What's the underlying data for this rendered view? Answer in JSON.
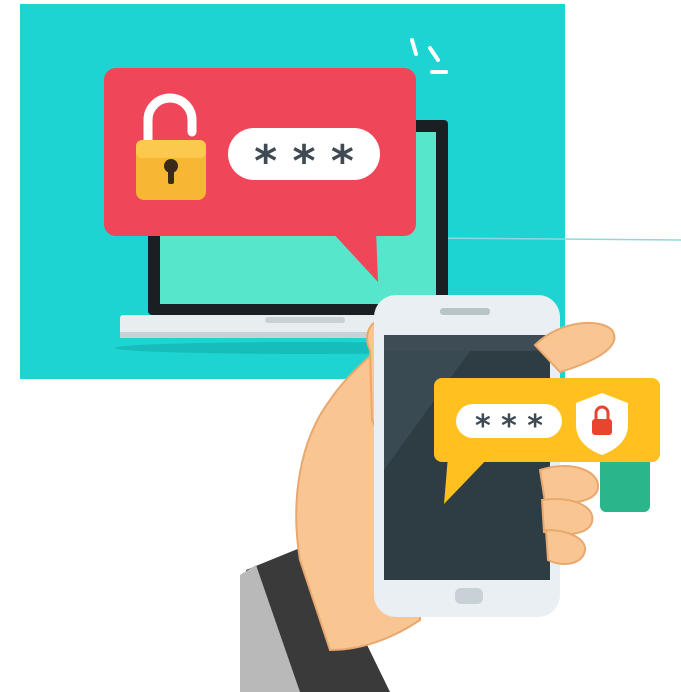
{
  "laptop_bubble": {
    "password_mask": "* * *"
  },
  "phone_bubble": {
    "password_mask": "* * *"
  },
  "colors": {
    "background_panel": "#1ED4D2",
    "alert_red": "#F0465A",
    "alert_yellow": "#FFC020",
    "lock_gold": "#F7B733",
    "shield_red": "#E8442E",
    "skin": "#F9C593",
    "sleeve": "#3A3A3A",
    "phone_screen": "#2E3C44",
    "laptop_screen": "#55E6CC"
  },
  "icons": {
    "laptop_bubble_icon": "open-padlock-icon",
    "phone_bubble_icon": "shield-lock-icon"
  }
}
